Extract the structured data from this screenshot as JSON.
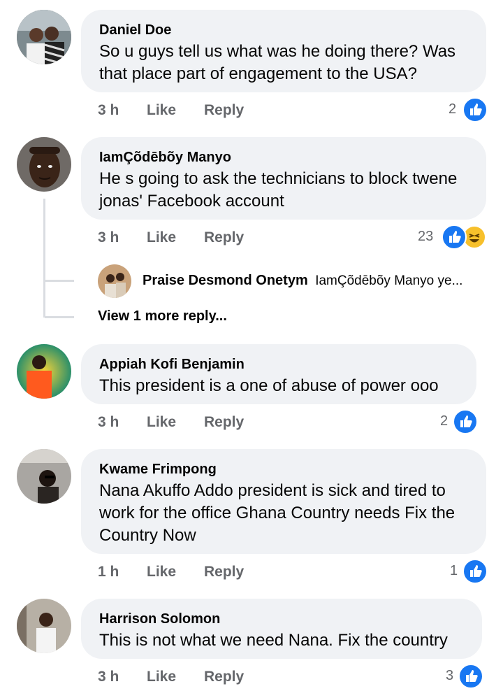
{
  "colors": {
    "bubble": "#f0f2f5",
    "like_blue": "#1877f2",
    "haha_yellow": "#f7c02b",
    "meta": "#65676b"
  },
  "comments": [
    {
      "name": "Daniel Doe",
      "text": "So u guys tell us what was he doing there? Was that place part of engagement to the USA?",
      "time": "3 h",
      "like": "Like",
      "reply": "Reply",
      "reactions": "2"
    },
    {
      "name": "IamÇõdēbõy Manyo",
      "text": "He s going to ask the technicians to block twene jonas' Facebook account",
      "time": "3 h",
      "like": "Like",
      "reply": "Reply",
      "reactions": "23"
    },
    {
      "name": "Appiah Kofi Benjamin",
      "text": "This president is a one of abuse of power ooo",
      "time": "3 h",
      "like": "Like",
      "reply": "Reply",
      "reactions": "2"
    },
    {
      "name": "Kwame Frimpong",
      "text": "Nana Akuffo Addo president is sick and tired to work for the office Ghana Country needs Fix the Country Now",
      "time": "1 h",
      "like": "Like",
      "reply": "Reply",
      "reactions": "1"
    },
    {
      "name": "Harrison Solomon",
      "text": "This is not what we need Nana. Fix the country",
      "time": "3 h",
      "like": "Like",
      "reply": "Reply",
      "reactions": "3"
    }
  ],
  "reply_preview": {
    "name": "Praise Desmond Onetym",
    "text": "IamÇõdēbõy Manyo ye..."
  },
  "view_more": "View 1 more reply...",
  "icons": {
    "like": "thumbs-up-icon",
    "haha": "laughing-emoji-icon"
  }
}
